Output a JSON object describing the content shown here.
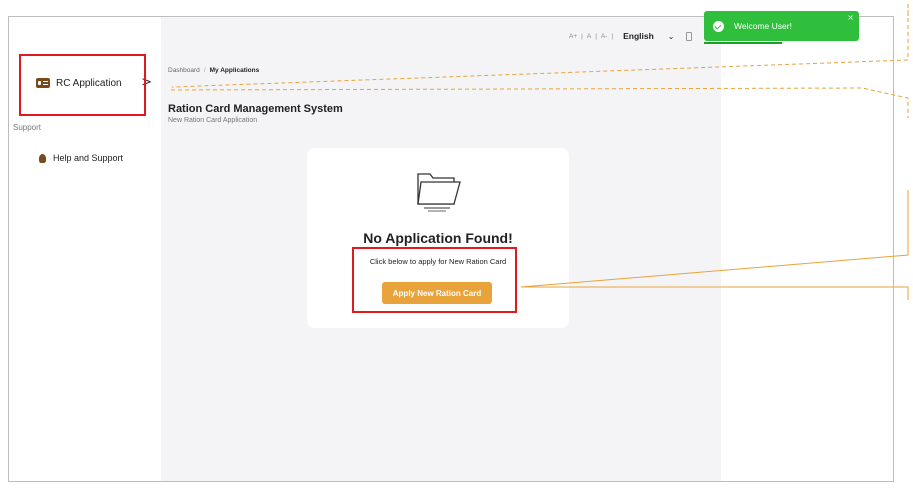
{
  "sidebar": {
    "rc_item_label": "RC Application",
    "rc_item_chevron": ">",
    "support_title": "Support",
    "help_label": "Help and Support"
  },
  "breadcrumb": {
    "root": "Dashboard",
    "separator": "/",
    "current": "My Applications"
  },
  "page": {
    "title": "Ration Card Management System",
    "subtitle": "New Ration Card Application"
  },
  "empty_state": {
    "title": "No Application Found!",
    "hint": "Click below to apply for New Ration Card",
    "button_label": "Apply New Ration Card"
  },
  "topbar": {
    "font_increase": "A+",
    "font_normal": "A",
    "font_decrease": "A-",
    "separator": "|",
    "language": "English",
    "dropdown_glyph": "⌄"
  },
  "toast": {
    "message": "Welcome User!",
    "close_glyph": "×"
  },
  "colors": {
    "accent": "#e8a33a",
    "brand_brown": "#7a4a1c",
    "toast_green": "#2fbf3c",
    "highlight_red": "#e0191f",
    "annotation_orange": "#e8a33a"
  }
}
